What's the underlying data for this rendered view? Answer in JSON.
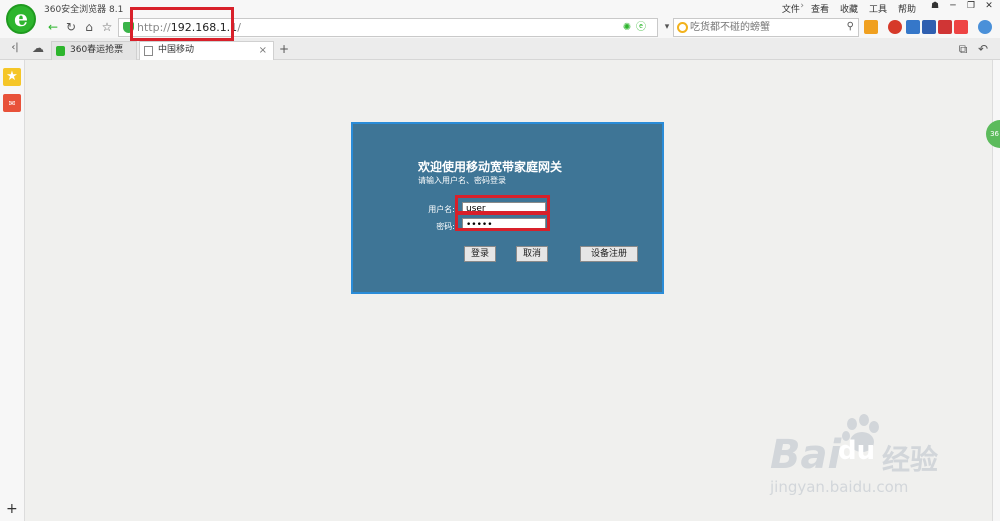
{
  "browser": {
    "app_title": "360安全浏览器 8.1",
    "menu": [
      "文件",
      "查看",
      "收藏",
      "工具",
      "帮助"
    ],
    "address": {
      "protocol": "http://",
      "host": "192.168.1.1",
      "path": "/"
    },
    "search_placeholder": "吃货都不碰的螃蟹",
    "tabs": [
      {
        "label": "360春运抢票",
        "active": false
      },
      {
        "label": "中国移动",
        "active": true
      }
    ],
    "new_tab_label": "+"
  },
  "login": {
    "title": "欢迎使用移动宽带家庭网关",
    "subtitle": "请输入用户名、密码登录",
    "username_label": "用户名:",
    "username_value": "user",
    "password_label": "密码:",
    "password_value": "admin",
    "buttons": {
      "login": "登录",
      "cancel": "取消",
      "register": "设备注册"
    }
  },
  "watermark": {
    "brand": "Bai",
    "brand2": "du",
    "suffix": "经验",
    "url": "jingyan.baidu.com"
  },
  "colors": {
    "panel_bg": "#3e7596",
    "panel_border": "#2a8cd8",
    "highlight": "#d8202a",
    "brand_green": "#2db52d"
  }
}
